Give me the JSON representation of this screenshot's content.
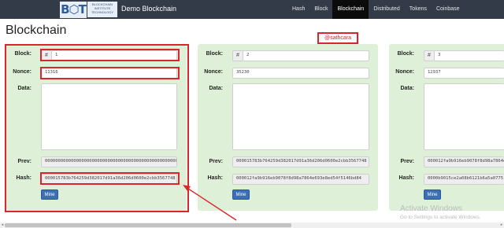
{
  "navbar": {
    "logo_mark": "B⬡T",
    "logo_lines": [
      "BLOCKCHAIN",
      "INSTITUTE",
      "TECHNOLOGY"
    ],
    "title": "Demo Blockchain",
    "items": [
      {
        "label": "Hash",
        "active": false
      },
      {
        "label": "Block",
        "active": false
      },
      {
        "label": "Blockchain",
        "active": true
      },
      {
        "label": "Distributed",
        "active": false
      },
      {
        "label": "Tokens",
        "active": false
      },
      {
        "label": "Coinbase",
        "active": false
      }
    ]
  },
  "page": {
    "title": "Blockchain"
  },
  "annotation": {
    "handle": "@sathcara"
  },
  "labels": {
    "block": "Block:",
    "nonce": "Nonce:",
    "data": "Data:",
    "prev": "Prev:",
    "hash": "Hash:",
    "prefix": "#",
    "mine": "Mine"
  },
  "blocks": [
    {
      "block": "1",
      "nonce": "11316",
      "data": "",
      "prev": "0000000000000000000000000000000000000000000000000000000000000000",
      "hash": "000015783b764259d382017d91a36d206d0600e2cbb3567748"
    },
    {
      "block": "2",
      "nonce": "35230",
      "data": "",
      "prev": "000015783b764259d382017d91a36d206d0600e2cbb3567748",
      "hash": "000012fa9b916eb9078f8d98a7864e693e8ed54f5146bd84"
    },
    {
      "block": "3",
      "nonce": "12937",
      "data": "",
      "prev": "000012fa9b916eb9078f8d98a7864e",
      "hash": "0000b9015ce2a08b6121b6a5a0775"
    }
  ],
  "watermark": {
    "line1": "Activate Windows",
    "line2": "Go to Settings to activate Windows."
  },
  "colors": {
    "navbar": "#323b47",
    "card": "#dff0d8",
    "button": "#3c6fb4",
    "highlight": "#d9262c"
  }
}
